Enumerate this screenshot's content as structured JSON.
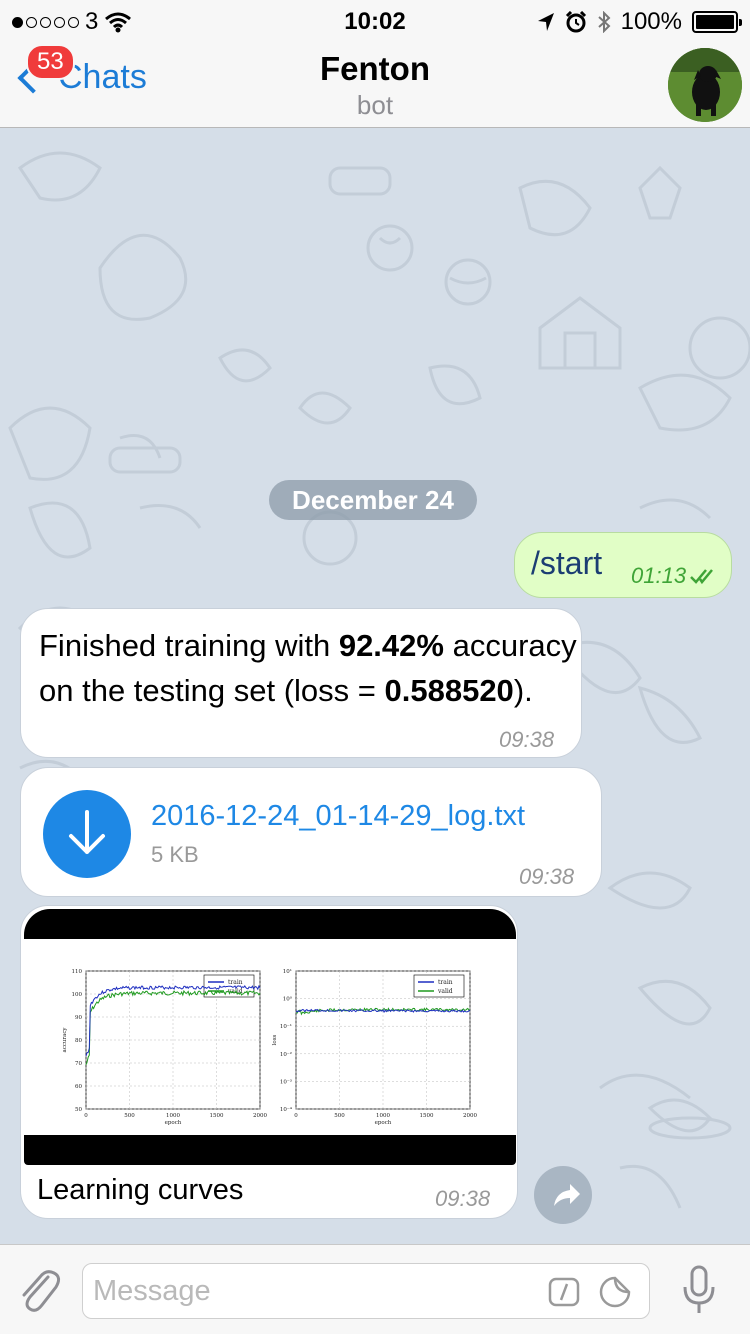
{
  "status_bar": {
    "carrier": "3",
    "time": "10:02",
    "battery": "100%"
  },
  "header": {
    "back_label": "Chats",
    "unread_badge": "53",
    "title": "Fenton",
    "subtitle": "bot"
  },
  "chat": {
    "date_separator": "December 24",
    "messages": [
      {
        "direction": "outgoing",
        "text": "/start",
        "time": "01:13"
      },
      {
        "direction": "incoming",
        "text_prefix": "Finished training with ",
        "bold_value": "92.42%",
        "text_middle": " accuracy on the testing set (loss = ",
        "bold_loss": "0.588520",
        "text_suffix": ").",
        "time": "09:38"
      },
      {
        "direction": "incoming",
        "file_name": "2016-12-24_01-14-29_log.txt",
        "file_size": "5 KB",
        "time": "09:38"
      },
      {
        "direction": "incoming",
        "caption": "Learning curves",
        "time": "09:38"
      }
    ]
  },
  "learning_curves": {
    "left_plot": {
      "ylabel": "accuracy",
      "xlabel": "epoch",
      "y_ticks": [
        "110",
        "100",
        "90",
        "80",
        "70",
        "60",
        "50"
      ],
      "x_ticks": [
        "0",
        "500",
        "1000",
        "1500",
        "2000"
      ],
      "legend": [
        "train",
        "valid"
      ]
    },
    "right_plot": {
      "ylabel": "loss",
      "xlabel": "epoch",
      "y_ticks": [
        "10¹",
        "10⁰",
        "10⁻¹",
        "10⁻²",
        "10⁻³",
        "10⁻⁴"
      ],
      "x_ticks": [
        "0",
        "500",
        "1000",
        "1500",
        "2000"
      ],
      "legend": [
        "train",
        "valid"
      ]
    },
    "colors": {
      "train": "#1f2fc0",
      "valid": "#1f9a1f"
    }
  },
  "input": {
    "placeholder": "Message"
  },
  "colors": {
    "accent": "#1c7cd6",
    "badge": "#f03b3b",
    "outgoing_bubble": "#e1fec6",
    "wallpaper": "#d5dee8"
  }
}
